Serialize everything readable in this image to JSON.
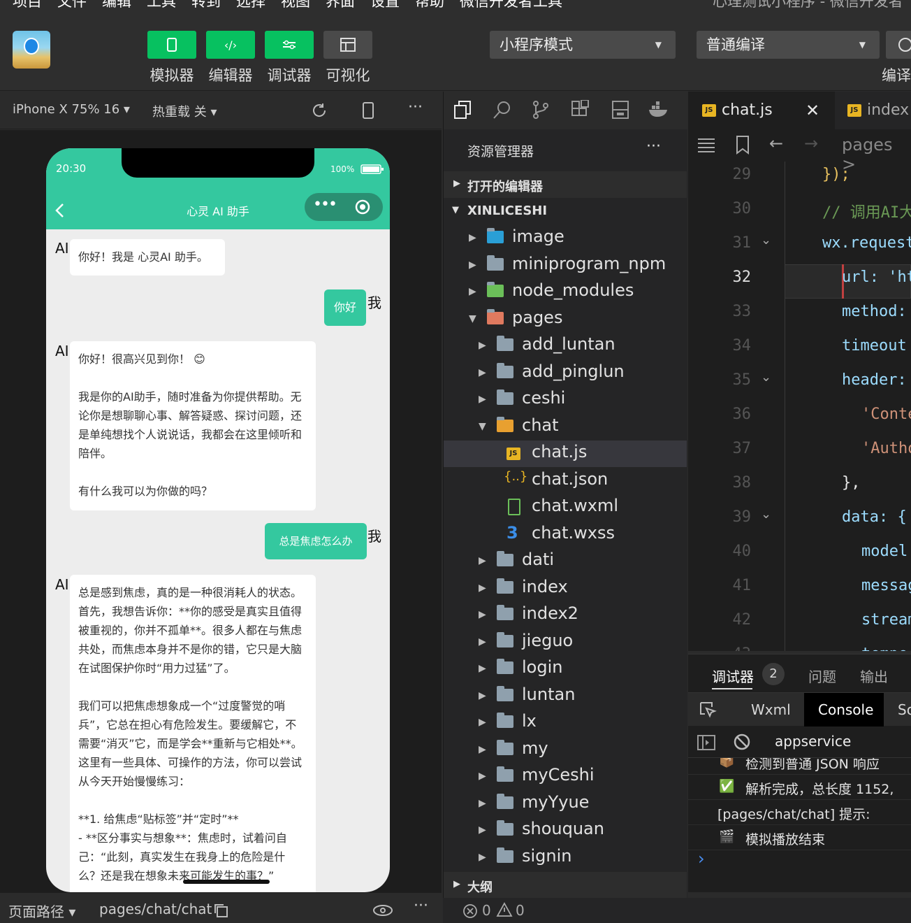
{
  "menubar": {
    "items": [
      "项目",
      "文件",
      "编辑",
      "工具",
      "转到",
      "选择",
      "视图",
      "界面",
      "设置",
      "帮助",
      "微信开发者工具"
    ],
    "title": "心理测试小程序 - 微信开发者"
  },
  "toolbar": {
    "buttons": [
      {
        "label": "模拟器",
        "icon": "phone-icon"
      },
      {
        "label": "编辑器",
        "icon": "code-icon"
      },
      {
        "label": "调试器",
        "icon": "debug-icon"
      },
      {
        "label": "可视化",
        "icon": "layout-icon"
      }
    ],
    "mode_select": "小程序模式",
    "compile_select": "普通编译",
    "compile_label": "编译"
  },
  "simulator": {
    "device": "iPhone X 75% 16 ▾",
    "hot_reload": "热重载 关 ▾",
    "status_time": "20:30",
    "battery": "100%",
    "nav_title": "心灵 AI 助手",
    "messages": [
      {
        "role": "ai",
        "who": "AI",
        "text": "你好！我是 心灵AI 助手。"
      },
      {
        "role": "me",
        "who": "我",
        "text": "你好"
      },
      {
        "role": "ai",
        "who": "AI",
        "text": "你好！很高兴见到你！ 😊\n\n我是你的AI助手，随时准备为你提供帮助。无论你是想聊聊心事、解答疑惑、探讨问题，还是单纯想找个人说说话，我都会在这里倾听和陪伴。\n\n有什么我可以为你做的吗？"
      },
      {
        "role": "me",
        "who": "我",
        "text": "总是焦虑怎么办"
      },
      {
        "role": "ai",
        "who": "AI",
        "text": "总是感到焦虑，真的是一种很消耗人的状态。首先，我想告诉你：**你的感受是真实且值得被重视的，你并不孤单**。很多人都在与焦虑共处，而焦虑本身并不是你的错，它只是大脑在试图保护你时“用力过猛”了。\n\n我们可以把焦虑想象成一个“过度警觉的哨兵”，它总在担心有危险发生。要缓解它，不需要“消灭”它，而是学会**重新与它相处**。这里有一些具体、可操作的方法，你可以尝试从今天开始慢慢练习：\n\n**1. 给焦虑“贴标签”并“定时”**\n- **区分事实与想象**：焦虑时，试着问自己：“此刻，真实发生在我身上的危险是什么？还是我在想象未来可能发生的事？”"
      }
    ],
    "path_label": "页面路径 ▾",
    "path_value": "pages/chat/chat"
  },
  "explorer": {
    "title": "资源管理器",
    "open_editors": "打开的编辑器",
    "project": "XINLICESHI",
    "outline": "大纲",
    "tree": [
      {
        "name": "image",
        "depth": 1,
        "kind": "folder-image",
        "open": false
      },
      {
        "name": "miniprogram_npm",
        "depth": 1,
        "kind": "folder",
        "open": false
      },
      {
        "name": "node_modules",
        "depth": 1,
        "kind": "folder-node",
        "open": false
      },
      {
        "name": "pages",
        "depth": 1,
        "kind": "folder-pages",
        "open": true
      },
      {
        "name": "add_luntan",
        "depth": 2,
        "kind": "folder",
        "open": false
      },
      {
        "name": "add_pinglun",
        "depth": 2,
        "kind": "folder",
        "open": false
      },
      {
        "name": "ceshi",
        "depth": 2,
        "kind": "folder",
        "open": false
      },
      {
        "name": "chat",
        "depth": 2,
        "kind": "folder-chat",
        "open": true
      },
      {
        "name": "chat.js",
        "depth": 3,
        "kind": "js",
        "selected": true
      },
      {
        "name": "chat.json",
        "depth": 3,
        "kind": "json"
      },
      {
        "name": "chat.wxml",
        "depth": 3,
        "kind": "wxml"
      },
      {
        "name": "chat.wxss",
        "depth": 3,
        "kind": "wxss"
      },
      {
        "name": "dati",
        "depth": 2,
        "kind": "folder",
        "open": false
      },
      {
        "name": "index",
        "depth": 2,
        "kind": "folder",
        "open": false
      },
      {
        "name": "index2",
        "depth": 2,
        "kind": "folder",
        "open": false
      },
      {
        "name": "jieguo",
        "depth": 2,
        "kind": "folder",
        "open": false
      },
      {
        "name": "login",
        "depth": 2,
        "kind": "folder",
        "open": false
      },
      {
        "name": "luntan",
        "depth": 2,
        "kind": "folder",
        "open": false
      },
      {
        "name": "lx",
        "depth": 2,
        "kind": "folder",
        "open": false
      },
      {
        "name": "my",
        "depth": 2,
        "kind": "folder",
        "open": false
      },
      {
        "name": "myCeshi",
        "depth": 2,
        "kind": "folder",
        "open": false
      },
      {
        "name": "myYyue",
        "depth": 2,
        "kind": "folder",
        "open": false
      },
      {
        "name": "shouquan",
        "depth": 2,
        "kind": "folder",
        "open": false
      },
      {
        "name": "signin",
        "depth": 2,
        "kind": "folder",
        "open": false
      }
    ]
  },
  "editor": {
    "tabs": [
      {
        "label": "chat.js",
        "active": true
      },
      {
        "label": "index",
        "active": false
      }
    ],
    "breadcrumb": "pages >",
    "lines": [
      {
        "n": "29",
        "code": "});"
      },
      {
        "n": "30",
        "code": "// 调用AI大"
      },
      {
        "n": "31",
        "code": "wx.request"
      },
      {
        "n": "32",
        "code": "url: 'ht"
      },
      {
        "n": "33",
        "code": "method:"
      },
      {
        "n": "34",
        "code": "timeout"
      },
      {
        "n": "35",
        "code": "header:"
      },
      {
        "n": "36",
        "code": "'Conte"
      },
      {
        "n": "37",
        "code": "'Autho"
      },
      {
        "n": "38",
        "code": "},"
      },
      {
        "n": "39",
        "code": "data: {"
      },
      {
        "n": "40",
        "code": "model"
      },
      {
        "n": "41",
        "code": "messag"
      },
      {
        "n": "42",
        "code": "stream"
      },
      {
        "n": "43",
        "code": "tempe"
      }
    ]
  },
  "debugger": {
    "tab": "调试器",
    "badge": "2",
    "problems": "问题",
    "output": "输出",
    "subtabs": [
      "Wxml",
      "Console",
      "So"
    ],
    "context": "appservice",
    "logs": [
      {
        "icon": "📦",
        "text": "检测到普通 JSON 响应"
      },
      {
        "icon": "✅",
        "text": "解析完成，总长度 1152,"
      },
      {
        "icon": "",
        "text": "[pages/chat/chat]  提示:"
      },
      {
        "icon": "🎬",
        "text": "模拟播放结束"
      }
    ],
    "prompt": "›"
  },
  "status": {
    "errors": "0",
    "warnings": "0"
  }
}
